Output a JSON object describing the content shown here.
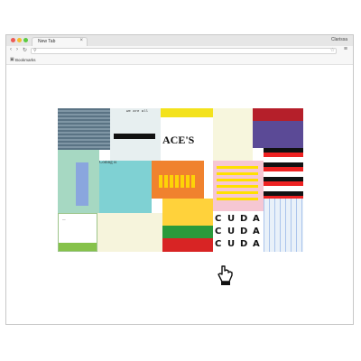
{
  "browser": {
    "tab_label": "New Tab",
    "profile": "Clarissa",
    "bookmarks_label": "Bookmarks",
    "omnibox_value": ""
  },
  "mosaic": {
    "tile_texts": {
      "we_are_all": "we are all",
      "aces": "ACE'S",
      "coding_is": "Coding is"
    },
    "glyph_rows": [
      [
        "C",
        "U",
        "D",
        "A"
      ],
      [
        "C",
        "U",
        "D",
        "A"
      ],
      [
        "C",
        "U",
        "D",
        "A"
      ]
    ]
  },
  "icons": {
    "star": "star-icon",
    "menu": "menu-icon",
    "back": "back-icon",
    "forward": "forward-icon",
    "reload": "reload-icon",
    "cursor": "hand-pointer-icon",
    "bookmark": "bookmark-icon"
  }
}
